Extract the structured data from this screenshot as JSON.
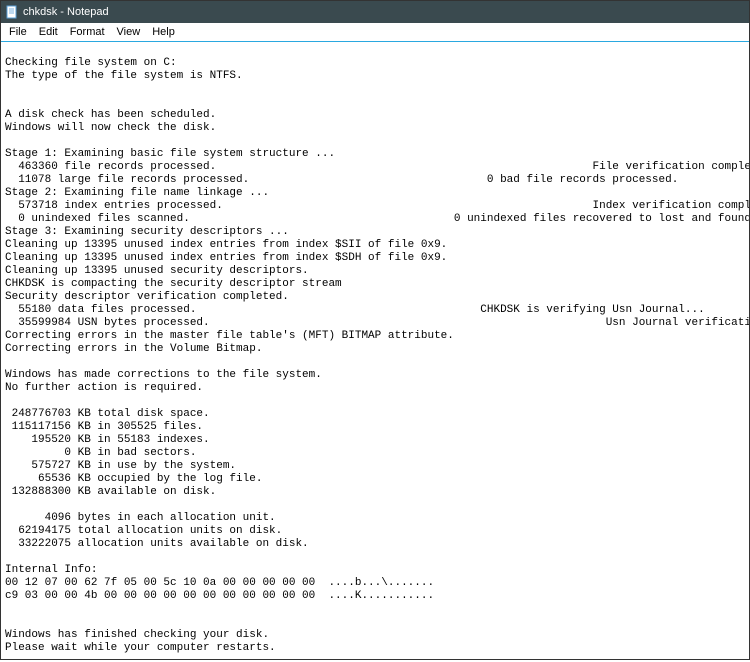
{
  "window": {
    "title": "chkdsk - Notepad"
  },
  "menu": {
    "file": "File",
    "edit": "Edit",
    "format": "Format",
    "view": "View",
    "help": "Help"
  },
  "editor": {
    "content": "\nChecking file system on C:\nThe type of the file system is NTFS.\n\n\nA disk check has been scheduled.\nWindows will now check the disk.\n\nStage 1: Examining basic file system structure ...\n  463360 file records processed.                                                         File verification completed.\n  11078 large file records processed.                                    0 bad file records processed.\nStage 2: Examining file name linkage ...\n  573718 index entries processed.                                                        Index verification completed.\n  0 unindexed files scanned.                                        0 unindexed files recovered to lost and found.\nStage 3: Examining security descriptors ...\nCleaning up 13395 unused index entries from index $SII of file 0x9.\nCleaning up 13395 unused index entries from index $SDH of file 0x9.\nCleaning up 13395 unused security descriptors.\nCHKDSK is compacting the security descriptor stream\nSecurity descriptor verification completed.\n  55180 data files processed.                                           CHKDSK is verifying Usn Journal...\n  35599984 USN bytes processed.                                                            Usn Journal verification completed.\nCorrecting errors in the master file table's (MFT) BITMAP attribute.\nCorrecting errors in the Volume Bitmap.\n\nWindows has made corrections to the file system.\nNo further action is required.\n\n 248776703 KB total disk space.\n 115117156 KB in 305525 files.\n    195520 KB in 55183 indexes.\n         0 KB in bad sectors.\n    575727 KB in use by the system.\n     65536 KB occupied by the log file.\n 132888300 KB available on disk.\n\n      4096 bytes in each allocation unit.\n  62194175 total allocation units on disk.\n  33222075 allocation units available on disk.\n\nInternal Info:\n00 12 07 00 62 7f 05 00 5c 10 0a 00 00 00 00 00  ....b...\\.......\nc9 03 00 00 4b 00 00 00 00 00 00 00 00 00 00 00  ....K...........\n\n\nWindows has finished checking your disk.\nPlease wait while your computer restarts.\n"
  }
}
